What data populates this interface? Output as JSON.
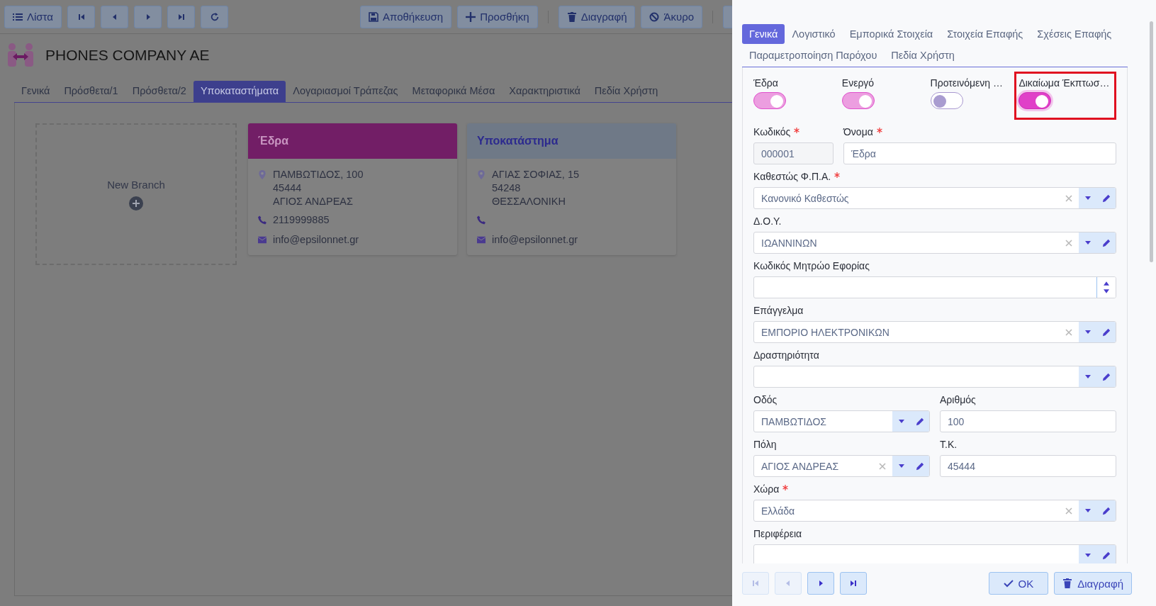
{
  "toolbar": {
    "list_button": "Λίστα",
    "save_button": "Αποθήκευση",
    "add_button": "Προσθήκη",
    "delete_button": "Διαγραφή",
    "cancel_button": "Άκυρο"
  },
  "header": {
    "title": "PHONES COMPANY AE"
  },
  "tabs": [
    {
      "label": "Γενικά",
      "selected": false
    },
    {
      "label": "Πρόσθετα/1",
      "selected": false
    },
    {
      "label": "Πρόσθετα/2",
      "selected": false
    },
    {
      "label": "Υποκαταστήματα",
      "selected": true
    },
    {
      "label": "Λογαριασμοί Τράπεζας",
      "selected": false
    },
    {
      "label": "Μεταφορικά Μέσα",
      "selected": false
    },
    {
      "label": "Χαρακτηριστικά",
      "selected": false
    },
    {
      "label": "Πεδία Χρήστη",
      "selected": false
    }
  ],
  "branches": {
    "new_label": "New Branch",
    "cards": [
      {
        "kind": "main",
        "title": "Έδρα",
        "address_lines": [
          "ΠΑΜΒΩΤΙΔΟΣ, 100",
          "45444",
          "ΑΓΙΟΣ ΑΝΔΡΕΑΣ"
        ],
        "phone": "2119999885",
        "email": "info@epsilonnet.gr"
      },
      {
        "kind": "branch",
        "title": "Υποκατάστημα",
        "address_lines": [
          "ΑΓΙΑΣ ΣΟΦΙΑΣ, 15",
          "54248",
          "ΘΕΣΣΑΛΟΝΙΚΗ"
        ],
        "email": "info@epsilonnet.gr"
      }
    ]
  },
  "drawer": {
    "tabs": [
      {
        "label": "Γενικά",
        "selected": true
      },
      {
        "label": "Λογιστικό",
        "selected": false
      },
      {
        "label": "Εμπορικά Στοιχεία",
        "selected": false
      },
      {
        "label": "Στοιχεία Επαφής",
        "selected": false
      },
      {
        "label": "Σχέσεις Επαφής",
        "selected": false
      },
      {
        "label": "Παραμετροποίηση Παρόχου",
        "selected": false
      },
      {
        "label": "Πεδία Χρήστη",
        "selected": false
      }
    ],
    "switches": [
      {
        "label": "Έδρα",
        "on": true,
        "disabled": true,
        "highlighted": false
      },
      {
        "label": "Ενεργό",
        "on": true,
        "disabled": true,
        "highlighted": false
      },
      {
        "label": "Προτεινόμενη …",
        "on": false,
        "disabled": false,
        "highlighted": false
      },
      {
        "label": "Δικαίωμα Έκπτωσ…",
        "on": true,
        "disabled": false,
        "highlighted": true
      }
    ],
    "rows": [
      [
        {
          "kind": "readonly",
          "label": "Κωδικός",
          "required": true,
          "value": "000001"
        },
        {
          "kind": "text",
          "label": "Όνομα",
          "required": true,
          "value": "Έδρα"
        }
      ],
      [
        {
          "kind": "combo",
          "label": "Καθεστώς Φ.Π.Α.",
          "required": true,
          "value": "Κανονικό Καθεστώς",
          "clearable": true
        }
      ],
      [
        {
          "kind": "combo",
          "label": "Δ.Ο.Υ.",
          "required": false,
          "value": "ΙΩΑΝΝΙΝΩΝ",
          "clearable": true
        }
      ],
      [
        {
          "kind": "number",
          "label": "Κωδικός Μητρώο Εφορίας",
          "required": false
        }
      ],
      [
        {
          "kind": "combo",
          "label": "Επάγγελμα",
          "required": false,
          "value": "ΕΜΠΟΡΙΟ ΗΛΕΚΤΡΟΝΙΚΩΝ",
          "clearable": true
        }
      ],
      [
        {
          "kind": "combo",
          "label": "Δραστηριότητα",
          "required": false,
          "clearable": false
        }
      ],
      [
        {
          "kind": "combo",
          "label": "Οδός",
          "required": false,
          "value": "ΠΑΜΒΩΤΙΔΟΣ",
          "clearable": false
        },
        {
          "kind": "text",
          "label": "Αριθμός",
          "required": false,
          "value": "100"
        }
      ],
      [
        {
          "kind": "combo",
          "label": "Πόλη",
          "required": false,
          "value": "ΑΓΙΟΣ ΑΝΔΡΕΑΣ",
          "clearable": true
        },
        {
          "kind": "text",
          "label": "Τ.Κ.",
          "required": false,
          "value": "45444"
        }
      ],
      [
        {
          "kind": "combo",
          "label": "Χώρα",
          "required": true,
          "value": "Ελλάδα",
          "clearable": true
        }
      ],
      [
        {
          "kind": "combo",
          "label": "Περιφέρεια",
          "required": false,
          "clearable": false
        }
      ]
    ],
    "pager": [
      {
        "kind": "first",
        "disabled": true
      },
      {
        "kind": "prev",
        "disabled": true
      },
      {
        "kind": "next",
        "disabled": false
      },
      {
        "kind": "last",
        "disabled": false
      }
    ],
    "ok_button": "OK",
    "delete_button": "Διαγραφή"
  }
}
